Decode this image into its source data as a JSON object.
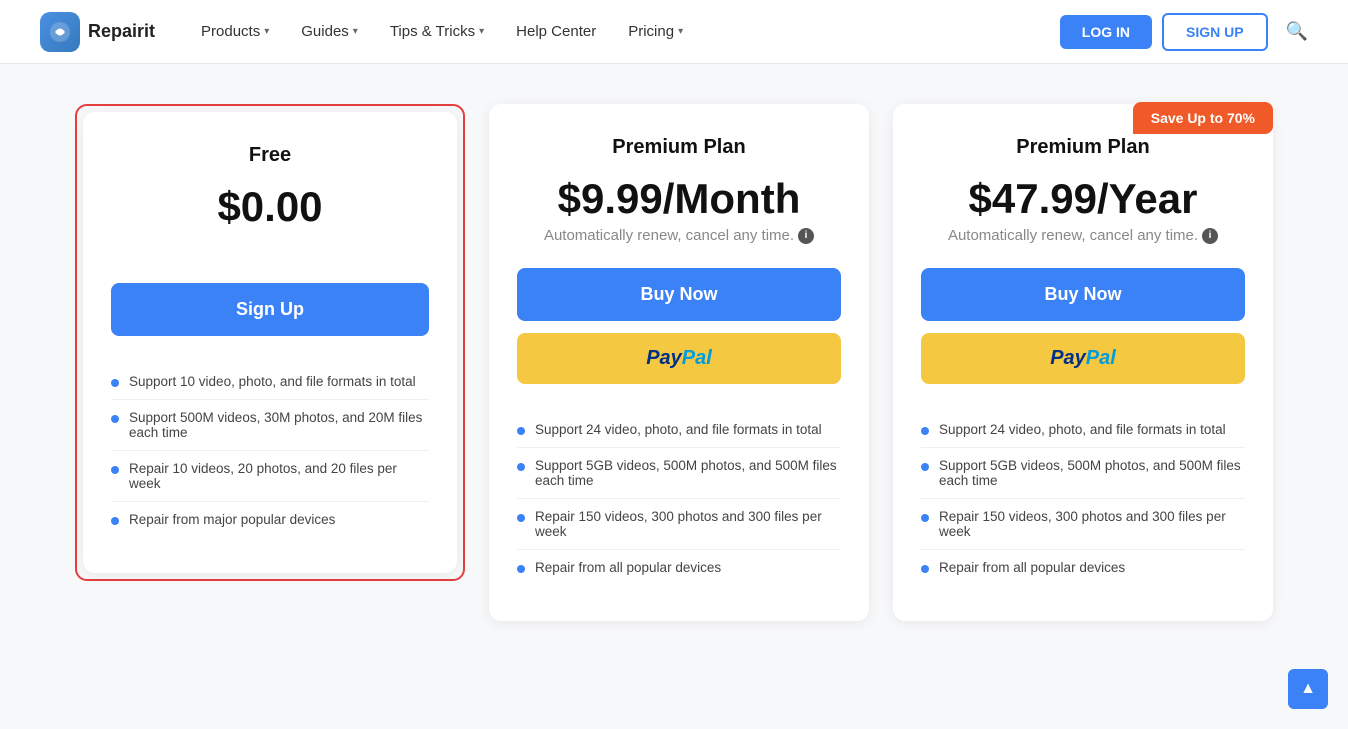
{
  "nav": {
    "logo_text": "Repairit",
    "items": [
      {
        "label": "Products",
        "has_dropdown": true
      },
      {
        "label": "Guides",
        "has_dropdown": true
      },
      {
        "label": "Tips & Tricks",
        "has_dropdown": true
      },
      {
        "label": "Help Center",
        "has_dropdown": false
      },
      {
        "label": "Pricing",
        "has_dropdown": true
      }
    ],
    "login_label": "LOG IN",
    "signup_label": "SIGN UP"
  },
  "plans": {
    "free": {
      "title": "Free",
      "price": "$0.00",
      "cta": "Sign Up",
      "features": [
        "Support 10 video, photo, and file formats in total",
        "Support 500M videos, 30M photos, and 20M files each time",
        "Repair 10 videos, 20 photos, and 20 files per week",
        "Repair from major popular devices"
      ]
    },
    "premium_monthly": {
      "title": "Premium Plan",
      "price": "$9.99/Month",
      "auto_renew": "Automatically renew, cancel any time.",
      "cta_buy": "Buy Now",
      "cta_paypal": "PayPal",
      "features": [
        "Support 24 video, photo, and file formats in total",
        "Support 5GB videos, 500M photos, and 500M files each time",
        "Repair 150 videos, 300 photos and 300 files per week",
        "Repair from all popular devices"
      ]
    },
    "premium_yearly": {
      "title": "Premium Plan",
      "price": "$47.99/Year",
      "save_badge": "Save Up to 70%",
      "auto_renew": "Automatically renew, cancel any time.",
      "cta_buy": "Buy Now",
      "cta_paypal": "PayPal",
      "features": [
        "Support 24 video, photo, and file formats in total",
        "Support 5GB videos, 500M photos, and 500M files each time",
        "Repair 150 videos, 300 photos and 300 files per week",
        "Repair from all popular devices"
      ]
    }
  }
}
